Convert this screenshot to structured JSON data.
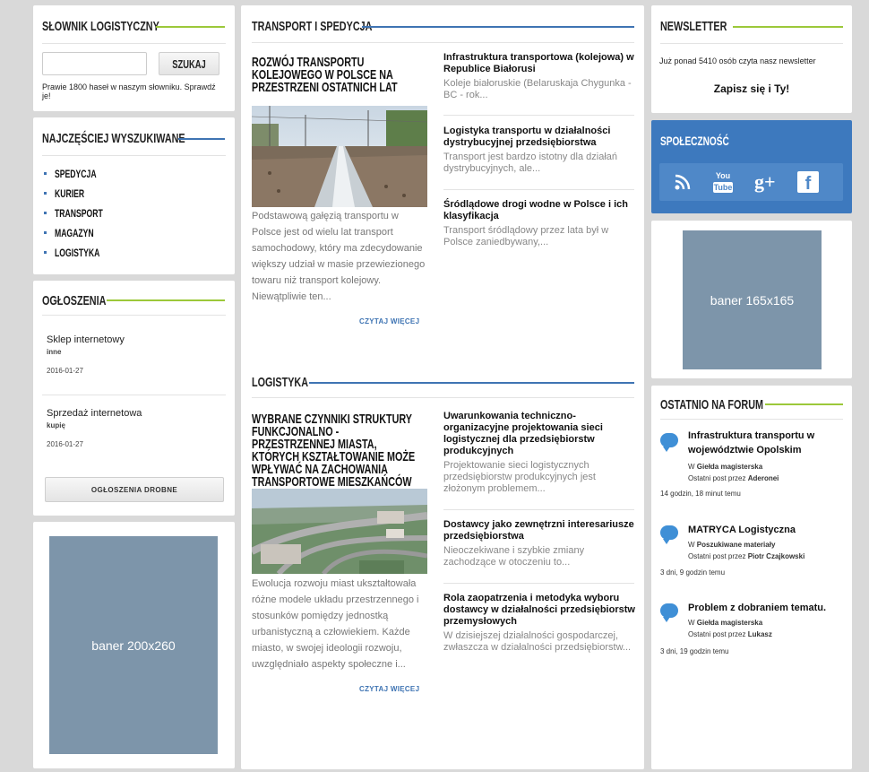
{
  "dictionary": {
    "title": "SŁOWNIK LOGISTYCZNY",
    "search_value": "",
    "search_button": "SZUKAJ",
    "note": "Prawie 1800 haseł w naszym słowniku. Sprawdź je!"
  },
  "popular": {
    "title": "NAJCZĘŚCIEJ WYSZUKIWANE",
    "items": [
      "SPEDYCJA",
      "KURIER",
      "TRANSPORT",
      "MAGAZYN",
      "LOGISTYKA"
    ]
  },
  "ads": {
    "title": "OGŁOSZENIA",
    "items": [
      {
        "title": "Sklep internetowy",
        "category": "inne",
        "date": "2016-01-27"
      },
      {
        "title": "Sprzedaż internetowa",
        "category": "kupię",
        "date": "2016-01-27"
      }
    ],
    "button": "OGŁOSZENIA DROBNE"
  },
  "banner_left": "baner 200x260",
  "transport": {
    "title": "TRANSPORT I SPEDYCJA",
    "lead": {
      "title": "ROZWÓJ TRANSPORTU KOLEJOWEGO W POLSCE NA PRZESTRZENI OSTATNICH LAT",
      "text": "Podstawową gałęzią transportu w Polsce jest od wielu lat transport samochodowy, który ma zdecydowanie większy udział w masie przewiezionego towaru niż transport kolejowy. Niewątpliwie ten...",
      "readmore": "CZYTAJ WIĘCEJ"
    },
    "articles": [
      {
        "title": "Infrastruktura transportowa (kolejowa) w Republice Białorusi",
        "excerpt": "Koleje białoruskie (Belaruskaja Chygunka - BC - rok..."
      },
      {
        "title": "Logistyka transportu w działalności dystrybucyjnej przedsiębiorstwa",
        "excerpt": "Transport jest bardzo istotny dla działań dystrybucyjnych, ale..."
      },
      {
        "title": "Śródlądowe drogi wodne w Polsce i ich klasyfikacja",
        "excerpt": "Transport śródlądowy przez lata był w Polsce zaniedbywany,..."
      }
    ]
  },
  "logistics": {
    "title": "LOGISTYKA",
    "lead": {
      "title": "WYBRANE CZYNNIKI STRUKTURY FUNKCJONALNO - PRZESTRZENNEJ MIASTA, KTÓRYCH KSZTAŁTOWANIE MOŻE WPŁYWAĆ NA ZACHOWANIA TRANSPORTOWE MIESZKAŃCÓW",
      "text": "Ewolucja rozwoju miast ukształtowała różne modele układu przestrzennego i stosunków pomiędzy jednostką urbanistyczną a człowiekiem. Każde miasto, w swojej ideologii rozwoju, uwzględniało aspekty społeczne i...",
      "readmore": "CZYTAJ WIĘCEJ"
    },
    "articles": [
      {
        "title": "Uwarunkowania techniczno-organizacyjne projektowania sieci logistycznej dla przedsiębiorstw produkcyjnych",
        "excerpt": "Projektowanie sieci logistycznych przedsiębiorstw produkcyjnych jest złożonym problemem..."
      },
      {
        "title": "Dostawcy jako zewnętrzni interesariusze przedsiębiorstwa",
        "excerpt": "Nieoczekiwane i szybkie zmiany zachodzące w otoczeniu to..."
      },
      {
        "title": "Rola zaopatrzenia i metodyka wyboru dostawcy w działalności przedsiębiorstw przemysłowych",
        "excerpt": "W dzisiejszej działalności gospodarczej, zwłaszcza w działalności przedsiębiorstw..."
      }
    ]
  },
  "newsletter": {
    "title": "NEWSLETTER",
    "count_text": "Już ponad 5410 osób czyta nasz newsletter",
    "cta": "Zapisz się i Ty!"
  },
  "community": {
    "title": "SPOŁECZNOŚĆ",
    "youtube_top": "You",
    "youtube_bottom": "Tube",
    "gplus": "g+",
    "facebook": "f"
  },
  "banner_right": "baner 165x165",
  "forum": {
    "title": "OSTATNIO NA FORUM",
    "posts": [
      {
        "title": "Infrastruktura transportu w województwie Opolskim",
        "in_label": "W",
        "board": "Giełda magisterska",
        "last_label": "Ostatni post przez",
        "author": "Aderonei",
        "time": "14 godzin, 18 minut temu"
      },
      {
        "title": "MATRYCA Logistyczna",
        "in_label": "W",
        "board": "Poszukiwane materiały",
        "last_label": "Ostatni post przez",
        "author": "Piotr Czajkowski",
        "time": "3 dni, 9 godzin temu"
      },
      {
        "title": "Problem z dobraniem tematu.",
        "in_label": "W",
        "board": "Giełda magisterska",
        "last_label": "Ostatni post przez",
        "author": "Lukasz",
        "time": "3 dni, 19 godzin temu"
      }
    ]
  },
  "colors": {
    "accent_green": "#9cc83a",
    "accent_blue": "#3f74b3",
    "community_bg": "#3d79be",
    "banner_bg": "#7d95aa"
  }
}
